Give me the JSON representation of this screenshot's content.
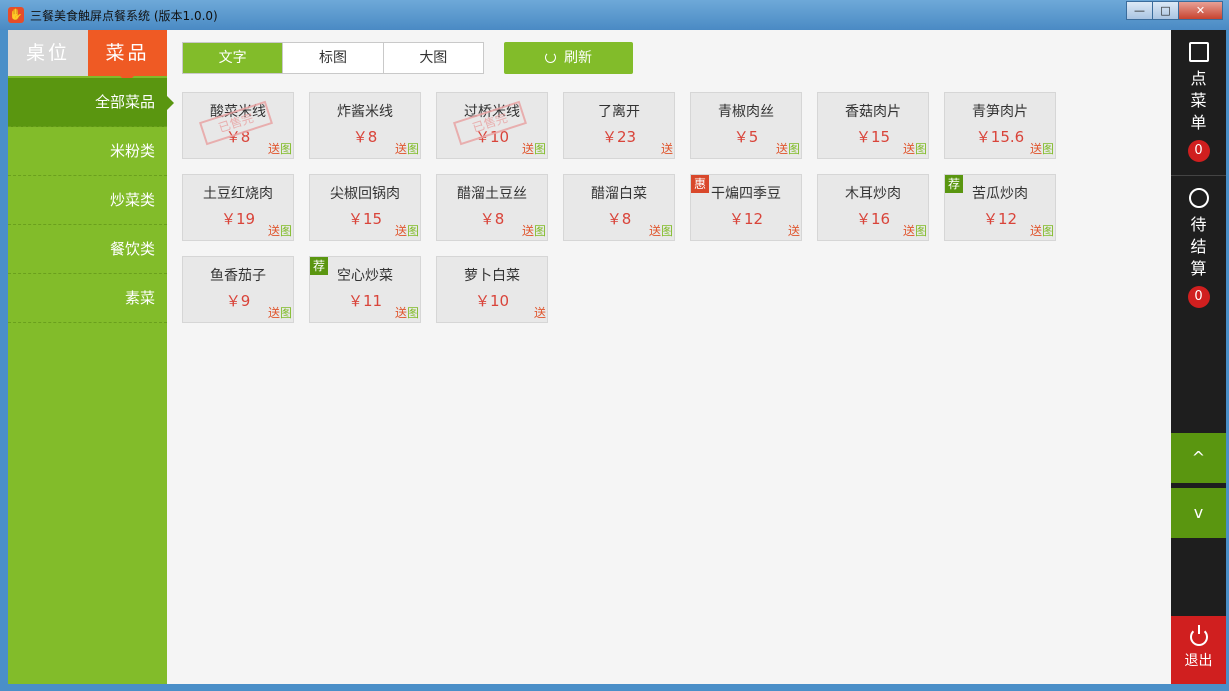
{
  "window": {
    "title": "三餐美食触屏点餐系统 (版本1.0.0)",
    "min_label": "—",
    "max_label": "□",
    "close_label": "✕"
  },
  "sidebar": {
    "tabs": [
      {
        "label": "桌位",
        "active": false
      },
      {
        "label": "菜品",
        "active": true
      }
    ],
    "categories": [
      "全部菜品",
      "米粉类",
      "炒菜类",
      "餐饮类",
      "素菜"
    ]
  },
  "toolbar": {
    "view_tabs": [
      "文字",
      "标图",
      "大图"
    ],
    "refresh_label": "刷新"
  },
  "dishes": [
    {
      "name": "酸菜米线",
      "price": "￥8",
      "tag_send": "送",
      "tag_img": "图",
      "sold_out": "已售完"
    },
    {
      "name": "炸酱米线",
      "price": "￥8",
      "tag_send": "送",
      "tag_img": "图"
    },
    {
      "name": "过桥米线",
      "price": "￥10",
      "tag_send": "送",
      "tag_img": "图",
      "sold_out": "已售完"
    },
    {
      "name": "了离开",
      "price": "￥23",
      "tag_send": "送"
    },
    {
      "name": "青椒肉丝",
      "price": "￥5",
      "tag_send": "送",
      "tag_img": "图"
    },
    {
      "name": "香菇肉片",
      "price": "￥15",
      "tag_send": "送",
      "tag_img": "图"
    },
    {
      "name": "青笋肉片",
      "price": "￥15.6",
      "tag_send": "送",
      "tag_img": "图"
    },
    {
      "name": "土豆红烧肉",
      "price": "￥19",
      "tag_send": "送",
      "tag_img": "图"
    },
    {
      "name": "尖椒回锅肉",
      "price": "￥15",
      "tag_send": "送",
      "tag_img": "图"
    },
    {
      "name": "醋溜土豆丝",
      "price": "￥8",
      "tag_send": "送",
      "tag_img": "图"
    },
    {
      "name": "醋溜白菜",
      "price": "￥8",
      "tag_send": "送",
      "tag_img": "图"
    },
    {
      "name": "干煸四季豆",
      "price": "￥12",
      "tag_send": "送",
      "badge": "惠"
    },
    {
      "name": "木耳炒肉",
      "price": "￥16",
      "tag_send": "送",
      "tag_img": "图"
    },
    {
      "name": "苦瓜炒肉",
      "price": "￥12",
      "tag_send": "送",
      "tag_img": "图",
      "badge": "荐"
    },
    {
      "name": "鱼香茄子",
      "price": "￥9",
      "tag_send": "送",
      "tag_img": "图"
    },
    {
      "name": "空心炒菜",
      "price": "￥11",
      "tag_send": "送",
      "tag_img": "图",
      "badge": "荐"
    },
    {
      "name": "萝卜白菜",
      "price": "￥10",
      "tag_send": "送"
    }
  ],
  "rightbar": {
    "order_label": "点菜单",
    "order_count": "0",
    "pending_label": "待结算",
    "pending_count": "0",
    "up_label": "^",
    "down_label": "v",
    "exit_label": "退出"
  },
  "colors": {
    "accent_green": "#82bc2a",
    "accent_orange": "#ef5a24",
    "price_red": "#d9443a",
    "badge_red": "#d01f1f"
  }
}
